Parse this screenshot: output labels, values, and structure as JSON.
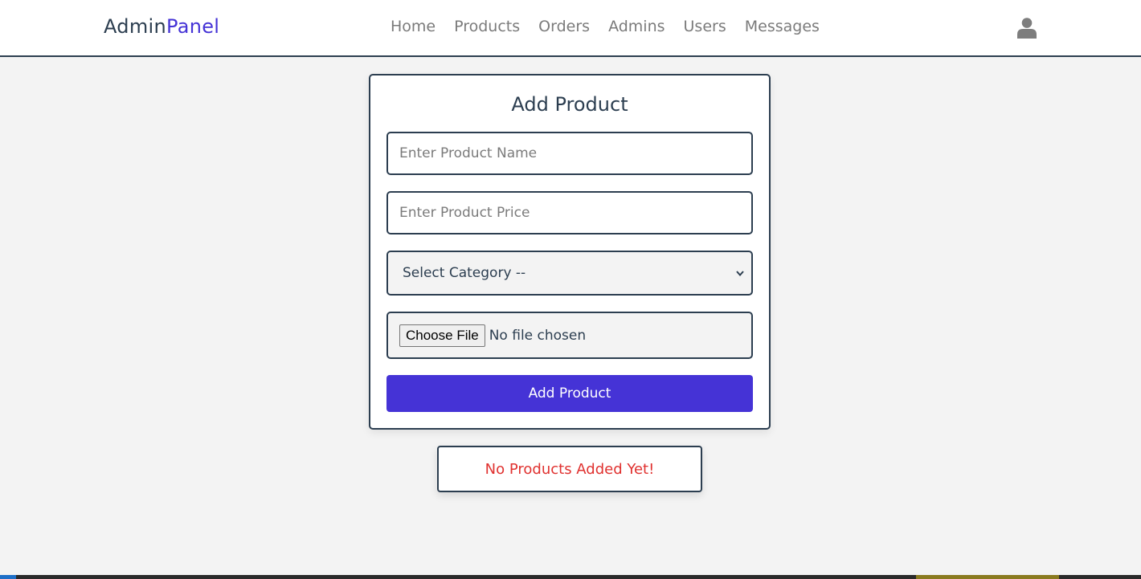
{
  "header": {
    "logo_main": "Admin",
    "logo_accent": "Panel",
    "nav": [
      "Home",
      "Products",
      "Orders",
      "Admins",
      "Users",
      "Messages"
    ],
    "user_icon": "user-icon"
  },
  "form": {
    "title": "Add Product",
    "name_placeholder": "Enter Product Name",
    "price_placeholder": "Enter Product Price",
    "category_selected": "Select Category --",
    "file_button": "Choose File",
    "file_status": "No file chosen",
    "submit_label": "Add Product"
  },
  "empty_message": "No Products Added Yet!",
  "colors": {
    "accent": "#4533d6",
    "text": "#2c3e50",
    "error": "#e0312f",
    "background": "#f3f3f3"
  }
}
